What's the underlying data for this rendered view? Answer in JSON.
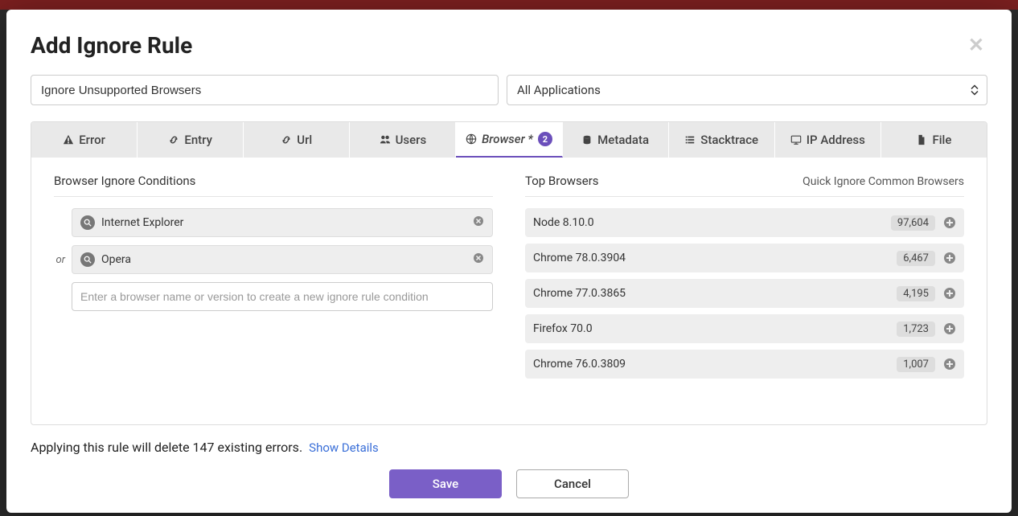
{
  "modal": {
    "title": "Add Ignore Rule",
    "rule_name": "Ignore Unsupported Browsers",
    "application": "All Applications"
  },
  "tabs": {
    "error": "Error",
    "entry": "Entry",
    "url": "Url",
    "users": "Users",
    "browser": "Browser *",
    "browser_badge": "2",
    "metadata": "Metadata",
    "stacktrace": "Stacktrace",
    "ip": "IP Address",
    "file": "File"
  },
  "conditions": {
    "title": "Browser Ignore Conditions",
    "or_label": "or",
    "items": [
      "Internet Explorer",
      "Opera"
    ],
    "placeholder": "Enter a browser name or version to create a new ignore rule condition"
  },
  "top_browsers": {
    "title": "Top Browsers",
    "quick_link": "Quick Ignore Common Browsers",
    "rows": [
      {
        "name": "Node 8.10.0",
        "count": "97,604"
      },
      {
        "name": "Chrome 78.0.3904",
        "count": "6,467"
      },
      {
        "name": "Chrome 77.0.3865",
        "count": "4,195"
      },
      {
        "name": "Firefox 70.0",
        "count": "1,723"
      },
      {
        "name": "Chrome 76.0.3809",
        "count": "1,007"
      }
    ]
  },
  "footer": {
    "message": "Applying this rule will delete 147 existing errors.",
    "details_link": "Show Details",
    "save": "Save",
    "cancel": "Cancel"
  }
}
